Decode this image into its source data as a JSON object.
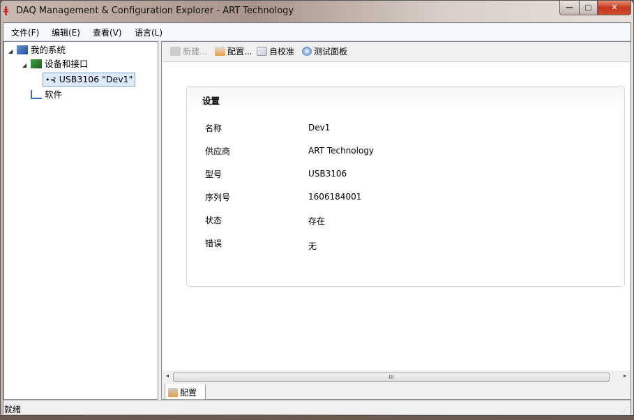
{
  "window": {
    "title": "DAQ Management & Configuration Explorer - ART Technology",
    "minimize": "—",
    "maximize": "▢",
    "close": "✕"
  },
  "menu": [
    "文件(F)",
    "编辑(E)",
    "查看(V)",
    "语言(L)"
  ],
  "tree": {
    "root": "我的系统",
    "devices": "设备和接口",
    "device": "USB3106 \"Dev1\"",
    "software": "软件"
  },
  "toolbar": {
    "new": "新建...",
    "config": "配置...",
    "calibrate": "自校准",
    "test_panel": "测试面板"
  },
  "settings": {
    "title": "设置",
    "rows": [
      {
        "label": "名称",
        "value": "Dev1"
      },
      {
        "label": "供应商",
        "value": "ART Technology"
      },
      {
        "label": "型号",
        "value": "USB3106"
      },
      {
        "label": "序列号",
        "value": "1606184001"
      },
      {
        "label": "状态",
        "value": "存在"
      },
      {
        "label": "错误",
        "value": "无"
      }
    ]
  },
  "scroll": {
    "grip": "III",
    "left": "◂",
    "right": "▸"
  },
  "tab": {
    "label": "配置"
  },
  "status": {
    "text": "就绪",
    "grip": "⋰"
  }
}
